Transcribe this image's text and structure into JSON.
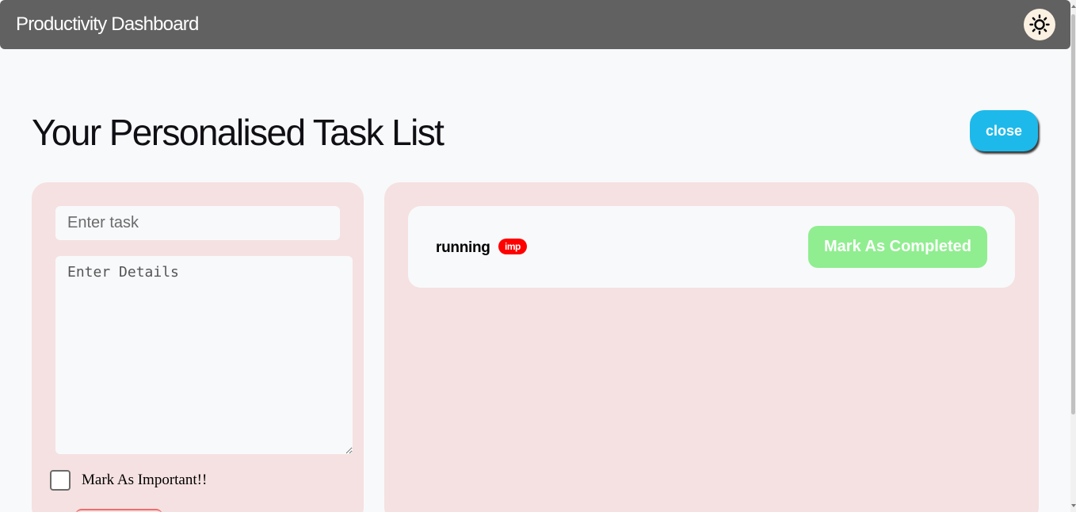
{
  "header": {
    "title": "Productivity Dashboard",
    "theme_icon": "sun-icon"
  },
  "main": {
    "title": "Your Personalised Task List",
    "close_label": "close"
  },
  "form": {
    "task_placeholder": "Enter task",
    "task_value": "",
    "details_placeholder": "Enter Details",
    "details_value": "",
    "important_label": "Mark As Important!!",
    "important_checked": false
  },
  "tasks": [
    {
      "name": "running",
      "badge": "imp",
      "action_label": "Mark As Completed"
    }
  ],
  "colors": {
    "header_bg": "#616161",
    "panel_bg": "#f5e1e1",
    "close_button": "#1db9ea",
    "complete_button": "#90ee90",
    "imp_badge": "#ff0000"
  }
}
